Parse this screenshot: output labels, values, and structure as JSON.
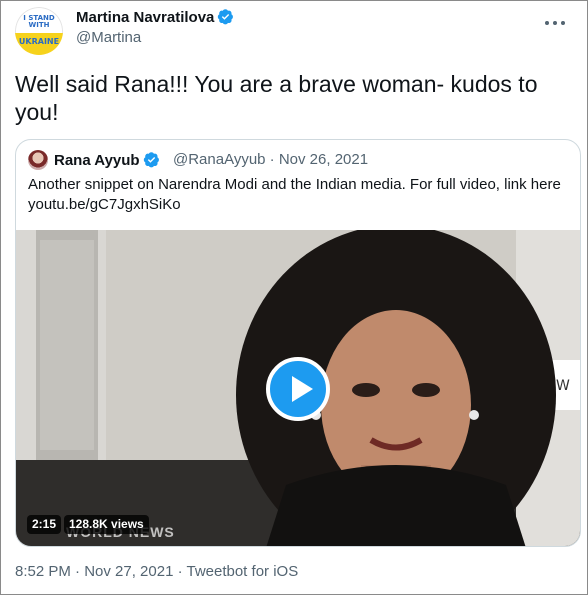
{
  "author": {
    "avatar_text_top": "I STAND WITH",
    "avatar_text_bottom": "UKRAINE",
    "name": "Martina Navratilova",
    "handle": "@Martina"
  },
  "tweet": {
    "text": "Well said Rana!!! You are a brave woman- kudos to you!"
  },
  "quoted": {
    "name": "Rana Ayyub",
    "handle_and_date": "@RanaAyyub · Nov 26, 2021",
    "text_line1": "Another snippet on Narendra Modi and the Indian media. For full video, link here",
    "link": "youtu.be/gC7JgxhSiKo",
    "media": {
      "duration": "2:15",
      "views": "128.8K views",
      "watermark": "WORLD NEWS",
      "corner_letter": "W"
    }
  },
  "footer": {
    "meta": "8:52 PM · Nov 27, 2021 · Tweetbot for iOS"
  },
  "colors": {
    "accent": "#1d9bf0",
    "text_primary": "#0f1419",
    "text_secondary": "#536471",
    "border": "#cfd9de"
  },
  "icons": [
    "verified-badge-icon",
    "more-options-icon",
    "play-icon"
  ]
}
